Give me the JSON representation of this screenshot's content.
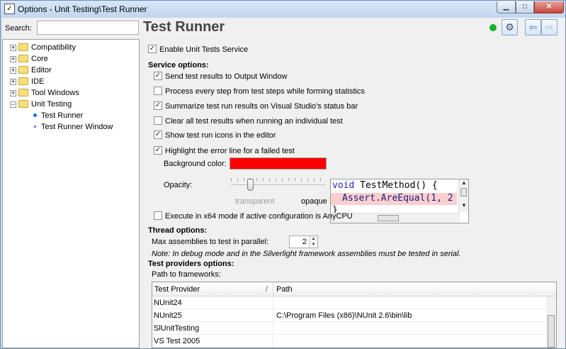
{
  "window": {
    "title": "Options - Unit Testing\\Test Runner",
    "minimize": "▁",
    "maximize": "□",
    "close": "✕"
  },
  "search": {
    "label": "Search:",
    "value": "",
    "placeholder": ""
  },
  "heading": "Test Runner",
  "status_color": "#16b22a",
  "toolbar": {
    "gear": "⚙",
    "back": "⇦",
    "forward": "⇨"
  },
  "tree": {
    "items": [
      {
        "label": "Compatibility",
        "expander": "+"
      },
      {
        "label": "Core",
        "expander": "+"
      },
      {
        "label": "Editor",
        "expander": "+"
      },
      {
        "label": "IDE",
        "expander": "+"
      },
      {
        "label": "Tool Windows",
        "expander": "+"
      },
      {
        "label": "Unit Testing",
        "expander": "−"
      }
    ],
    "children": [
      {
        "label": "Test Runner"
      },
      {
        "label": "Test Runner Window"
      }
    ]
  },
  "enable_label": "Enable Unit Tests Service",
  "service": {
    "heading": "Service options:",
    "options": [
      {
        "label": "Send test results to Output Window",
        "checked": "✓"
      },
      {
        "label": "Process every step from test steps while forming statistics",
        "checked": ""
      },
      {
        "label": "Summarize test run results on Visual Studio's status bar",
        "checked": "✓"
      },
      {
        "label": "Clear all test results when running an individual test",
        "checked": ""
      },
      {
        "label": "Show test run icons in the editor",
        "checked": "✓"
      },
      {
        "label": "Highlight the error line for a failed test",
        "checked": "✓"
      }
    ],
    "background_label": "Background color:",
    "background_color": "#ff0000",
    "opacity_label": "Opacity:",
    "opacity_value": 0.2,
    "transparent": "transparent",
    "opaque": "opaque",
    "x64_label": "Execute in x64 mode if active configuration is AnyCPU",
    "x64_checked": ""
  },
  "code": {
    "kw": "void",
    "line1": " TestMethod() {",
    "line2": "Assert.AreEqual(1, 2",
    "line3": "}",
    "up": "▲",
    "down": "▼",
    "hthumb": "|||"
  },
  "thread": {
    "heading": "Thread options:",
    "max_label": "Max assemblies to test in parallel:",
    "max_value": "2",
    "note": "Note: In debug mode and in the Silverlight framework assemblies must be tested in serial."
  },
  "providers": {
    "heading": "Test providers options:",
    "path_label": "Path to frameworks:",
    "columns": [
      "Test Provider",
      "Path"
    ],
    "sort_icon": "/",
    "rows": [
      {
        "provider": "NUnit24",
        "path": ""
      },
      {
        "provider": "NUnit25",
        "path": "C:\\Program Files (x86)\\NUnit 2.6\\bin\\lib"
      },
      {
        "provider": "SlUnitTesting",
        "path": ""
      },
      {
        "provider": "VS Test 2005",
        "path": ""
      }
    ]
  }
}
